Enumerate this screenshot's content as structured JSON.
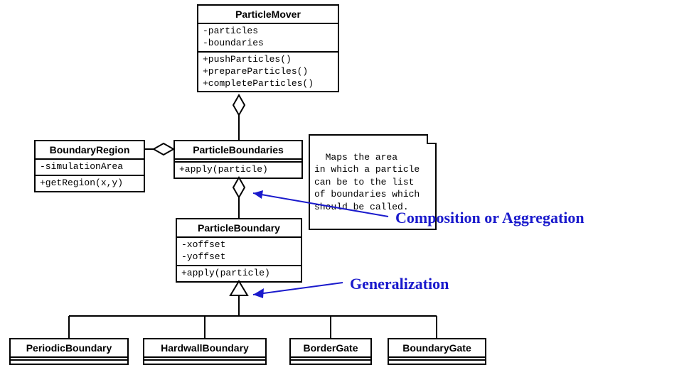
{
  "classes": {
    "ParticleMover": {
      "name": "ParticleMover",
      "attributes": "-particles\n-boundaries",
      "operations": "+pushParticles()\n+prepareParticles()\n+completeParticles()"
    },
    "BoundaryRegion": {
      "name": "BoundaryRegion",
      "attributes": "-simulationArea",
      "operations": "+getRegion(x,y)"
    },
    "ParticleBoundaries": {
      "name": "ParticleBoundaries",
      "attributes": "",
      "operations": "+apply(particle)"
    },
    "ParticleBoundary": {
      "name": "ParticleBoundary",
      "attributes": "-xoffset\n-yoffset",
      "operations": "+apply(particle)"
    },
    "PeriodicBoundary": {
      "name": "PeriodicBoundary"
    },
    "HardwallBoundary": {
      "name": "HardwallBoundary"
    },
    "BorderGate": {
      "name": "BorderGate"
    },
    "BoundaryGate": {
      "name": "BoundaryGate"
    }
  },
  "note": {
    "text": "Maps the area\nin which a particle\ncan be to the list\nof boundaries which\nshould be called."
  },
  "labels": {
    "composition": "Composition or  Aggregation",
    "generalization": "Generalization"
  },
  "relationships": [
    {
      "from": "ParticleMover",
      "to": "ParticleBoundaries",
      "type": "aggregation"
    },
    {
      "from": "ParticleBoundaries",
      "to": "BoundaryRegion",
      "type": "aggregation"
    },
    {
      "from": "ParticleBoundaries",
      "to": "ParticleBoundary",
      "type": "aggregation"
    },
    {
      "from": "ParticleBoundary",
      "to": "PeriodicBoundary",
      "type": "generalization"
    },
    {
      "from": "ParticleBoundary",
      "to": "HardwallBoundary",
      "type": "generalization"
    },
    {
      "from": "ParticleBoundary",
      "to": "BorderGate",
      "type": "generalization"
    },
    {
      "from": "ParticleBoundary",
      "to": "BoundaryGate",
      "type": "generalization"
    }
  ]
}
